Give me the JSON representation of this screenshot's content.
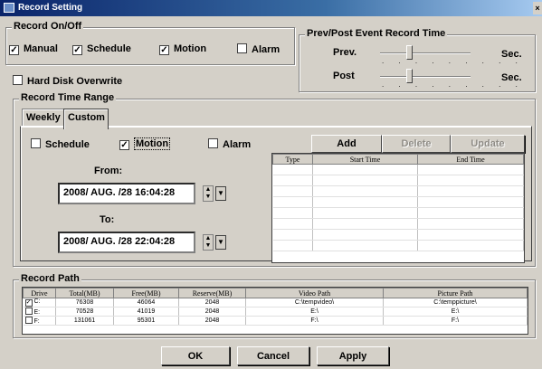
{
  "window": {
    "title": "Record Setting"
  },
  "record_onoff": {
    "legend": "Record On/Off",
    "manual": {
      "label": "Manual",
      "checked": true
    },
    "schedule": {
      "label": "Schedule",
      "checked": true
    },
    "motion": {
      "label": "Motion",
      "checked": true
    },
    "alarm": {
      "label": "Alarm",
      "checked": false
    }
  },
  "hard_disk_overwrite": {
    "label": "Hard Disk Overwrite",
    "checked": false
  },
  "prev_post": {
    "legend": "Prev/Post Event Record Time",
    "prev_label": "Prev.",
    "post_label": "Post",
    "unit": "Sec."
  },
  "record_time_range": {
    "legend": "Record Time Range",
    "tabs": [
      {
        "label": "Weekly"
      },
      {
        "label": "Custom"
      }
    ],
    "active_tab": "Custom",
    "schedule": {
      "label": "Schedule",
      "checked": false
    },
    "motion": {
      "label": "Motion",
      "checked": true
    },
    "alarm": {
      "label": "Alarm",
      "checked": false
    },
    "from_label": "From:",
    "from_value": "2008/ AUG. /28 16:04:28",
    "to_label": "To:",
    "to_value": "2008/ AUG. /28 22:04:28",
    "add_label": "Add",
    "delete_label": "Delete",
    "update_label": "Update",
    "columns": [
      "Type",
      "Start Time",
      "End Time"
    ]
  },
  "record_path": {
    "legend": "Record Path",
    "columns": [
      "Drive",
      "Total(MB)",
      "Free(MB)",
      "Reserve(MB)",
      "Video Path",
      "Picture Path"
    ],
    "rows": [
      {
        "checked": true,
        "drive": "C:",
        "total": "76308",
        "free": "46064",
        "reserve": "2048",
        "video": "C:\\tempvideo\\",
        "picture": "C:\\temppicture\\"
      },
      {
        "checked": false,
        "drive": "E:",
        "total": "70528",
        "free": "41019",
        "reserve": "2048",
        "video": "E:\\",
        "picture": "E:\\"
      },
      {
        "checked": false,
        "drive": "F:",
        "total": "131061",
        "free": "95301",
        "reserve": "2048",
        "video": "F:\\",
        "picture": "F:\\"
      }
    ]
  },
  "buttons": {
    "ok": "OK",
    "cancel": "Cancel",
    "apply": "Apply"
  }
}
